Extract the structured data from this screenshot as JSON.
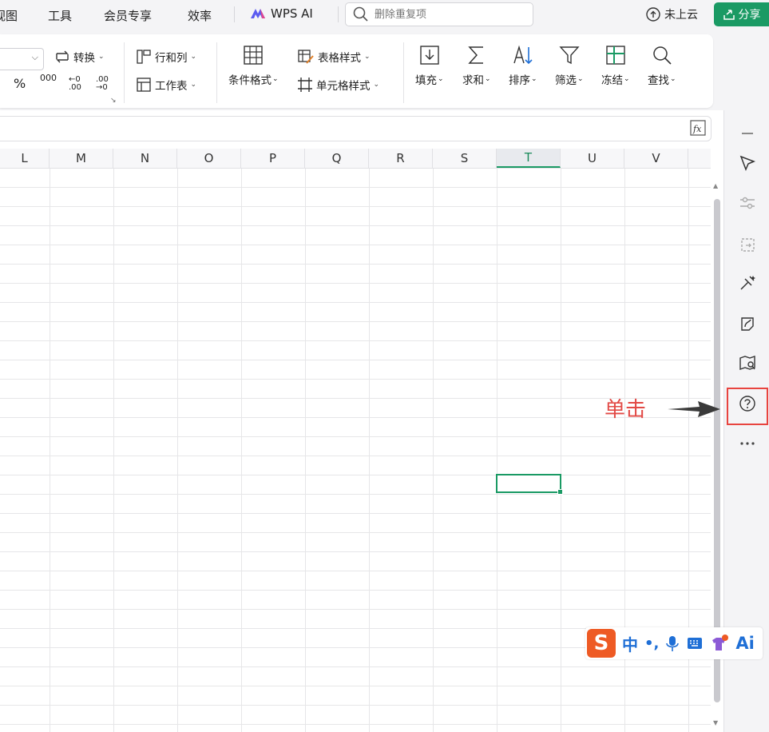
{
  "menu": {
    "items": [
      "视图",
      "工具",
      "会员专享",
      "效率"
    ],
    "wps_ai": "WPS AI",
    "search_placeholder": "删除重复项",
    "cloud": "未上云",
    "share": "分享"
  },
  "ribbon": {
    "convert": "转换",
    "rows_cols": "行和列",
    "worksheet": "工作表",
    "cond_format": "条件格式",
    "table_style": "表格样式",
    "cell_style": "单元格样式",
    "fill": "填充",
    "sum": "求和",
    "sort": "排序",
    "filter": "筛选",
    "freeze": "冻结",
    "find": "查找",
    "fmt_percent": "%",
    "fmt_thousand": "000",
    "fmt_dec_inc": "←0 .00",
    "fmt_dec_dec": ".00 →0"
  },
  "columns": [
    "L",
    "M",
    "N",
    "O",
    "P",
    "Q",
    "R",
    "S",
    "T",
    "U",
    "V"
  ],
  "active_column": "T",
  "annotation": "单击",
  "ime": {
    "zh": "中",
    "punct": "•,",
    "ai": "Ai"
  },
  "colors": {
    "accent": "#1a9a64",
    "highlight": "#e8443f",
    "ime_brand": "#ee5a24"
  }
}
